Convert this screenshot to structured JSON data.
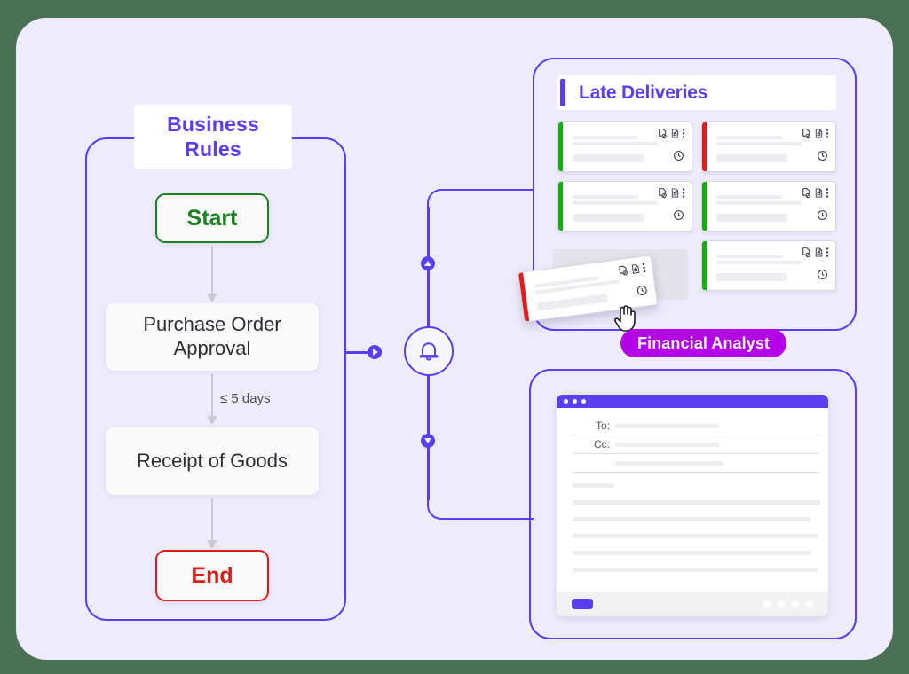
{
  "colors": {
    "canvas_bg": "#eeecfc",
    "accent_purple": "#5a3ef0",
    "badge_magenta": "#b300e8",
    "status_green": "#11b00e",
    "status_red": "#e51b1b",
    "start_green": "#1a8020",
    "end_red": "#e01b1b"
  },
  "flow": {
    "title": "Business\nRules",
    "title_line1": "Business",
    "title_line2": "Rules",
    "start_label": "Start",
    "end_label": "End",
    "steps": [
      {
        "label": "Purchase Order Approval"
      },
      {
        "label": "Receipt of Goods"
      }
    ],
    "edge_label": "≤ 5 days"
  },
  "connector": {
    "bell_icon": "bell-icon",
    "node_left_icon": "play-triangle-right-icon",
    "node_up_icon": "triangle-up-icon",
    "node_down_icon": "triangle-down-icon"
  },
  "deliveries": {
    "title": "Late Deliveries",
    "cards": [
      {
        "status": "green"
      },
      {
        "status": "red"
      },
      {
        "status": "green"
      },
      {
        "status": "green"
      },
      {
        "status": "green"
      }
    ],
    "dragged_card": {
      "status": "red"
    },
    "card_icons": [
      "document-link-icon",
      "document-lock-icon",
      "more-vertical-icon"
    ],
    "card_clock_icon": "clock-icon",
    "cursor_icon": "hand-pointer-cursor",
    "role_badge": "Financial Analyst"
  },
  "email": {
    "titlebar_dots": 3,
    "fields": [
      {
        "label": "To:"
      },
      {
        "label": "Cc:"
      },
      {
        "label": ""
      }
    ],
    "body_line_count": 6,
    "send_button": "",
    "footer_dots": 4
  }
}
